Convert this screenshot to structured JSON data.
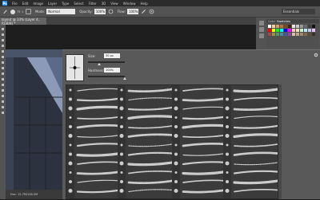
{
  "menu": {
    "logo": "Ps",
    "items": [
      "File",
      "Edit",
      "Image",
      "Layer",
      "Type",
      "Select",
      "Filter",
      "3D",
      "View",
      "Window",
      "Help"
    ]
  },
  "options": {
    "brush_size": "75",
    "mode_label": "Mode:",
    "mode_value": "Normal",
    "opacity_label": "Opacity:",
    "opacity_value": "100%",
    "flow_label": "Flow:",
    "flow_value": "100%",
    "workspace": "Essentials"
  },
  "document": {
    "tab_title": "layout @ 33% (Layer 4, RGB/8) *",
    "status": "Doc: 15.7M/146.0M"
  },
  "swatches": {
    "tabs": [
      "Color",
      "Swatches"
    ],
    "colors": [
      "#ffffff",
      "#f2d6a0",
      "#d9a15b",
      "#b3733a",
      "#7b4a23",
      "#3c2410",
      "#e8e8e8",
      "#c9c9c9",
      "#9a9a9a",
      "#6b6b6b",
      "#3f3f3f",
      "#111111",
      "#ff0000",
      "#ffff00",
      "#00ff00",
      "#00ffff",
      "#0000ff",
      "#ff00ff",
      "#f7c6c6",
      "#f9e3b5",
      "#c8f0c8",
      "#bfe7f2",
      "#c2c6f5",
      "#e9c3ef",
      "#9c4a4a",
      "#9c8e4a",
      "#4a9c58",
      "#4a8b9c",
      "#4a579c",
      "#8a4a9c",
      "#d6c2a3",
      "#bfa88a",
      "#a08a6a",
      "#7f6a4e",
      "#5f4c35",
      "#403224"
    ]
  },
  "brush_picker": {
    "size_label": "Size:",
    "size_value": "30 px",
    "hardness_label": "Hardness:",
    "hardness_value": "100%",
    "size_level": 0.3,
    "hardness_level": 1.0
  }
}
